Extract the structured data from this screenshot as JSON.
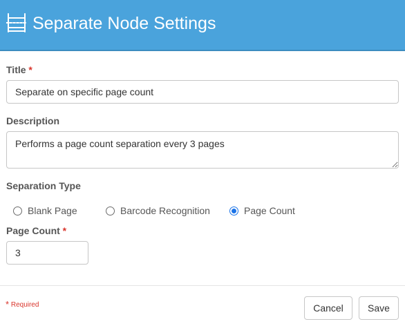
{
  "header": {
    "title": "Separate Node Settings",
    "icon": "separate-node-icon",
    "background_color": "#4aa3dc"
  },
  "form": {
    "title": {
      "label": "Title",
      "required_mark": "*",
      "value": "Separate on specific page count"
    },
    "description": {
      "label": "Description",
      "value": "Performs a page count separation every 3 pages"
    },
    "separation_type": {
      "label": "Separation Type",
      "options": [
        {
          "label": "Blank Page",
          "checked": false
        },
        {
          "label": "Barcode Recognition",
          "checked": false
        },
        {
          "label": "Page Count",
          "checked": true
        }
      ]
    },
    "page_count": {
      "label": "Page Count",
      "required_mark": "*",
      "value": "3"
    }
  },
  "footer": {
    "required_star": "*",
    "required_note": "Required",
    "cancel_label": "Cancel",
    "save_label": "Save"
  },
  "colors": {
    "required": "#d9342b",
    "radio_checked": "#1a73e8"
  }
}
